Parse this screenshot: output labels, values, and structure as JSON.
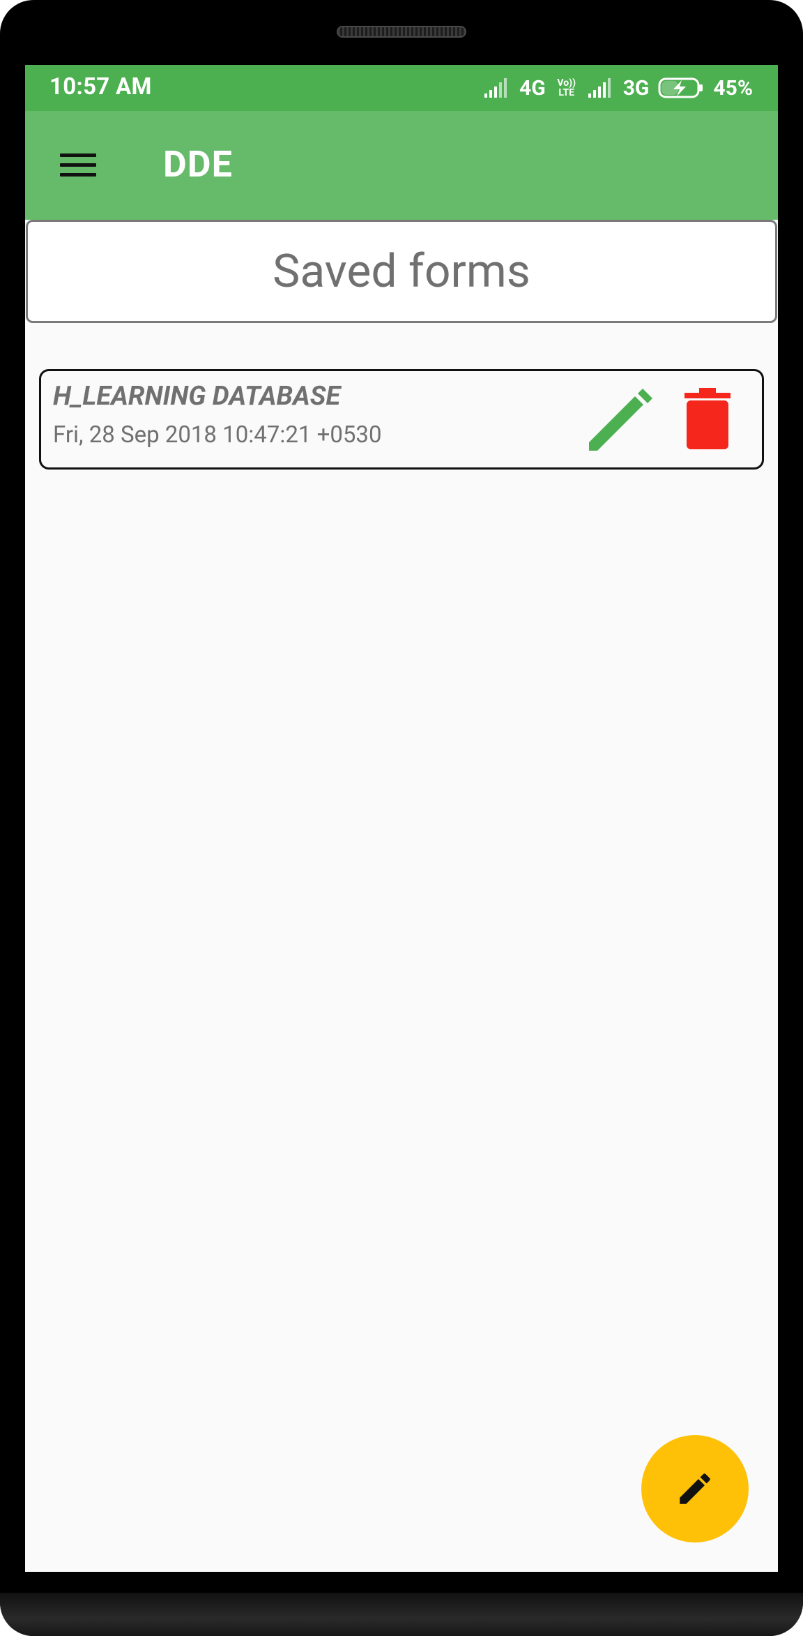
{
  "status_bar": {
    "time": "10:57 AM",
    "network_1": "4G",
    "volte_line1": "Vo))",
    "volte_line2": "LTE",
    "network_2": "3G",
    "battery": "45%"
  },
  "app_bar": {
    "title": "DDE",
    "menu_icon": "hamburger-menu-icon"
  },
  "header": {
    "title": "Saved forms"
  },
  "saved_forms": [
    {
      "name": "H_LEARNING DATABASE",
      "date": "Fri, 28 Sep 2018 10:47:21 +0530",
      "edit_icon": "pencil-icon",
      "delete_icon": "trash-icon"
    }
  ],
  "fab": {
    "icon": "pencil-icon"
  },
  "colors": {
    "status_bar": "#4caf50",
    "app_bar": "#66bb6a",
    "edit": "#4caf50",
    "delete": "#f5261b",
    "fab": "#ffc107",
    "text_secondary": "#707070"
  }
}
